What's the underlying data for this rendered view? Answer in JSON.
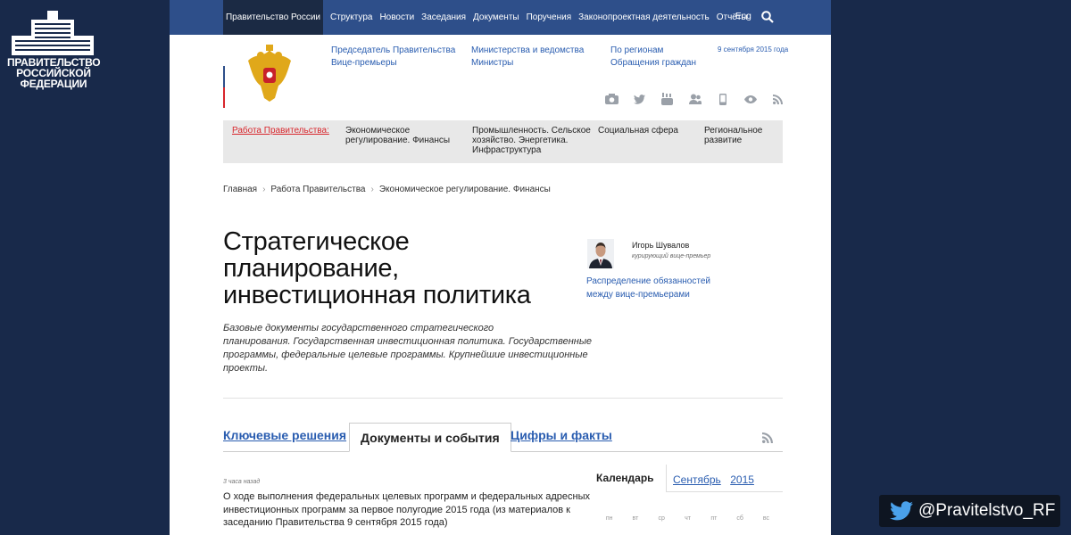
{
  "brand": {
    "lines": [
      "ПРАВИТЕЛЬСТВО",
      "РОССИЙСКОЙ",
      "ФЕДЕРАЦИИ"
    ]
  },
  "twitter": {
    "handle": "@Pravitelstvo_RF",
    "icon": "twitter-bird-icon"
  },
  "topnav": {
    "home": "Правительство России",
    "links": [
      "Структура",
      "Новости",
      "Заседания",
      "Документы",
      "Поручения",
      "Законопроектная деятельность",
      "Отчёты"
    ],
    "lang": "Eng",
    "search_icon": "search-icon",
    "bg_color": "#2e4f8a"
  },
  "header": {
    "col1": [
      "Председатель Правительства",
      "Вице-премьеры"
    ],
    "col2": [
      "Министерства и ведомства",
      "Министры"
    ],
    "col3": [
      "По регионам",
      "Обращения граждан"
    ],
    "date": "9 сентября 2015 года",
    "social_icons": [
      "camera-icon",
      "twitter-icon",
      "youtube-icon",
      "people-icon",
      "mobile-icon",
      "eye-icon",
      "rss-icon"
    ]
  },
  "workbar": {
    "label": "Работа Правительства:",
    "items": [
      [
        "Экономическое",
        "регулирование. Финансы"
      ],
      [
        "Промышленность. Сельское",
        "хозяйство. Энергетика.",
        "Инфраструктура"
      ],
      [
        "Социальная сфера"
      ],
      [
        "Региональное",
        "развитие"
      ]
    ]
  },
  "breadcrumb": [
    "Главная",
    "Работа Правительства",
    "Экономическое регулирование. Финансы"
  ],
  "page": {
    "title_lines": [
      "Стратегическое",
      "планирование,",
      "инвестиционная политика"
    ],
    "lead_lines": [
      "Базовые документы государственного стратегического",
      "планирования. Государственная инвестиционная политика. Государственные",
      "программы, федеральные целевые программы. Крупнейшие инвестиционные",
      "проекты."
    ]
  },
  "curator": {
    "name": "Игорь Шувалов",
    "role": "курирующий вице-премьер",
    "link_lines": [
      "Распределение обязанностей",
      "между вице-премьерами"
    ]
  },
  "tabs": [
    "Ключевые решения",
    "Документы и события",
    "Цифры и факты"
  ],
  "news": {
    "time": "3 часа назад",
    "text_lines": [
      "О ходе выполнения федеральных целевых программ и федеральных адресных",
      "инвестиционных программ за первое полугодие 2015 года (из материалов к",
      "заседанию Правительства 9 сентября 2015 года)"
    ]
  },
  "calendar": {
    "title": "Календарь",
    "month": "Сентябрь",
    "year": "2015",
    "weekdays": [
      "пн",
      "вт",
      "ср",
      "чт",
      "пт",
      "сб",
      "вс"
    ]
  }
}
